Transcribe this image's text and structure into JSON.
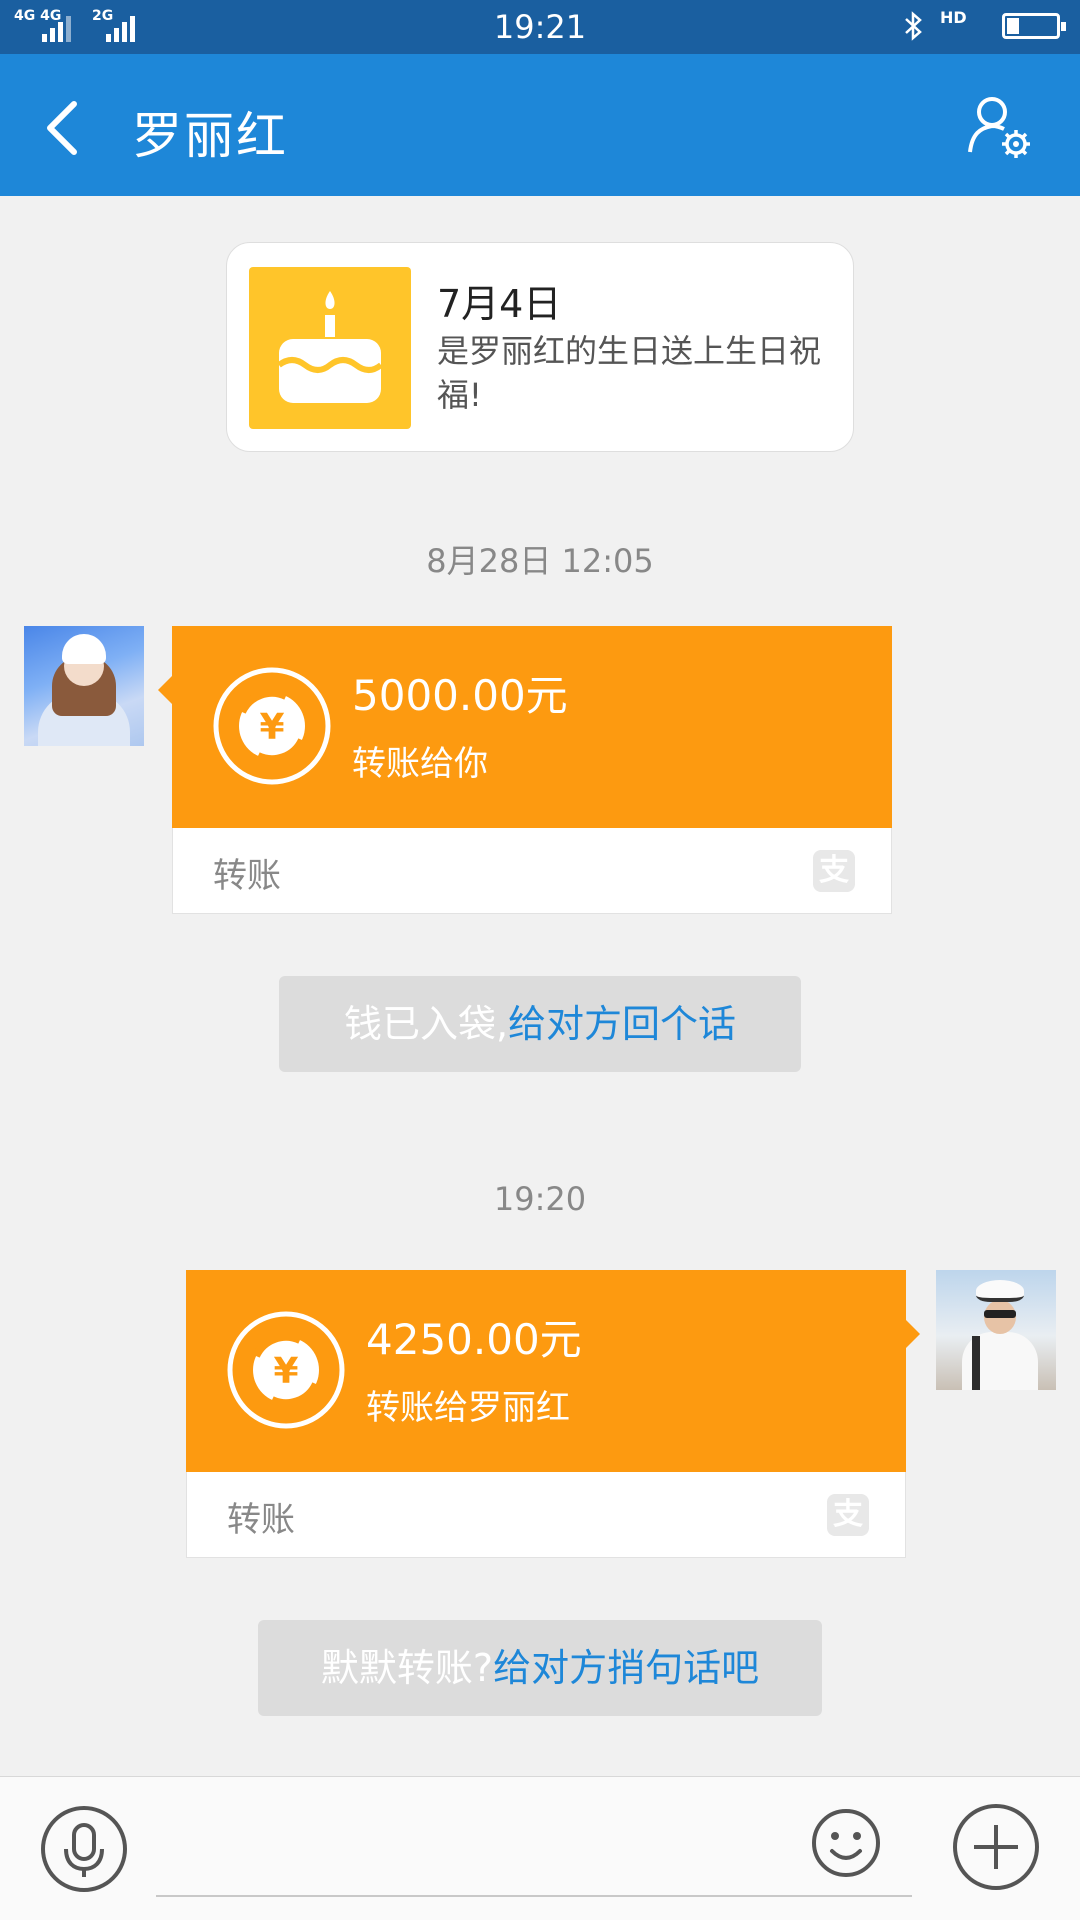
{
  "status_bar": {
    "time": "19:21",
    "network_1": "4G 4G",
    "network_2": "2G",
    "hd": "HD",
    "battery_level": 0.25
  },
  "header": {
    "title": "罗丽红"
  },
  "birthday_card": {
    "date": "7月4日",
    "text": "是罗丽红的生日送上生日祝福!"
  },
  "messages": [
    {
      "timestamp": "8月28日 12:05",
      "side": "left",
      "amount": "5000.00元",
      "desc": "转账给你",
      "kind": "转账",
      "notice_text": "钱已入袋,",
      "notice_link": "给对方回个话"
    },
    {
      "timestamp": "19:20",
      "side": "right",
      "amount": "4250.00元",
      "desc": "转账给罗丽红",
      "kind": "转账",
      "notice_text": "默默转账?",
      "notice_link": "给对方捎句话吧"
    }
  ],
  "input_bar": {
    "placeholder": ""
  },
  "colors": {
    "app_bar": "#1e87d8",
    "status_bar": "#1a5fa0",
    "transfer_orange": "#fd9a10",
    "link_blue": "#1e87d8",
    "birthday_yellow": "#ffc52a"
  }
}
